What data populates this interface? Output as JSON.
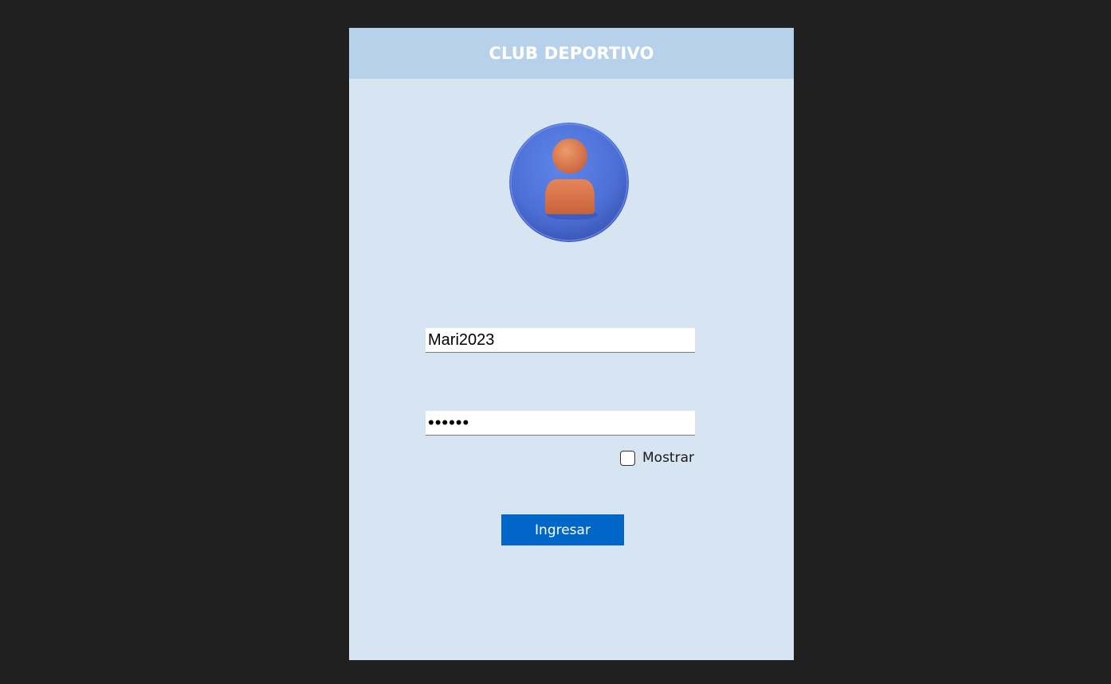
{
  "header": {
    "title": "CLUB DEPORTIVO"
  },
  "avatar": {
    "icon": "user-avatar-icon",
    "circle_color": "#4e72d9",
    "figure_color": "#e07a4f"
  },
  "form": {
    "username_value": "Mari2023",
    "password_value": "••••••",
    "show_label": "Mostrar",
    "show_checked": false,
    "submit_label": "Ingresar"
  },
  "colors": {
    "background": "#202020",
    "panel": "#d7e4f2",
    "header": "#b8d1ea",
    "button": "#0067c8"
  }
}
